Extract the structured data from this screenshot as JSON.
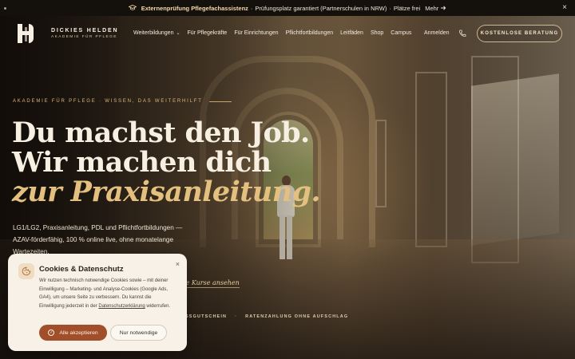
{
  "announcement": {
    "icon": "graduation-cap-icon",
    "highlight": "Externenprüfung Pflegefachassistenz",
    "separator1": "·",
    "text": "Prüfungsplatz garantiert (Partnerschulen in NRW)",
    "separator2": "·",
    "suffix": "Plätze frei",
    "more_label": "Mehr",
    "close_label": "×"
  },
  "nav": {
    "brand": "DICKIES HELDEN",
    "brand_sub": "AKADEMIE FÜR PFLEGE",
    "items": [
      {
        "label": "Weiterbildungen",
        "dropdown": true
      },
      {
        "label": "Für Pflegekräfte"
      },
      {
        "label": "Für Einrichtungen"
      },
      {
        "label": "Pflichtfortbildungen"
      },
      {
        "label": "Leitfäden"
      },
      {
        "label": "Shop"
      },
      {
        "label": "Campus"
      }
    ],
    "login": "Anmelden",
    "cta": "KOSTENLOSE BERATUNG"
  },
  "hero": {
    "eyebrow": "AKADEMIE FÜR PFLEGE · WISSEN, DAS WEITERHILFT",
    "headline_line1": "Du machst den Job.",
    "headline_line2": "Wir machen dich",
    "headline_accent": "zur Praxisanleitung.",
    "lead": "LG1/LG2, Praxisanleitung, PDL und Pflichtfortbildungen — AZAV-förderfähig, 100 % online live, ohne monatelange Wartezeiten.",
    "courses_link": "ie Kurse ansehen",
    "feature_1": "SSGUTSCHEIN",
    "feature_bullet": "·",
    "feature_2": "RATENZAHLUNG OHNE AUFSCHLAG"
  },
  "cookie": {
    "title": "Cookies & Datenschutz",
    "body_before_link": "Wir nutzen technisch notwendige Cookies sowie – mit deiner Einwilligung – Marketing- und Analyse-Cookies (Google Ads, GA4), um unsere Seite zu verbessern. Du kannst die Einwilligung jederzeit in der ",
    "link": "Datenschutzerklärung",
    "body_after_link": " widerrufen.",
    "accept": "Alle akzeptieren",
    "necessary": "Nur notwendige",
    "close_label": "×"
  },
  "colors": {
    "accent_gold": "#e3c07f",
    "cookie_button": "#a14e2a",
    "topbar_bg": "#14100c"
  }
}
